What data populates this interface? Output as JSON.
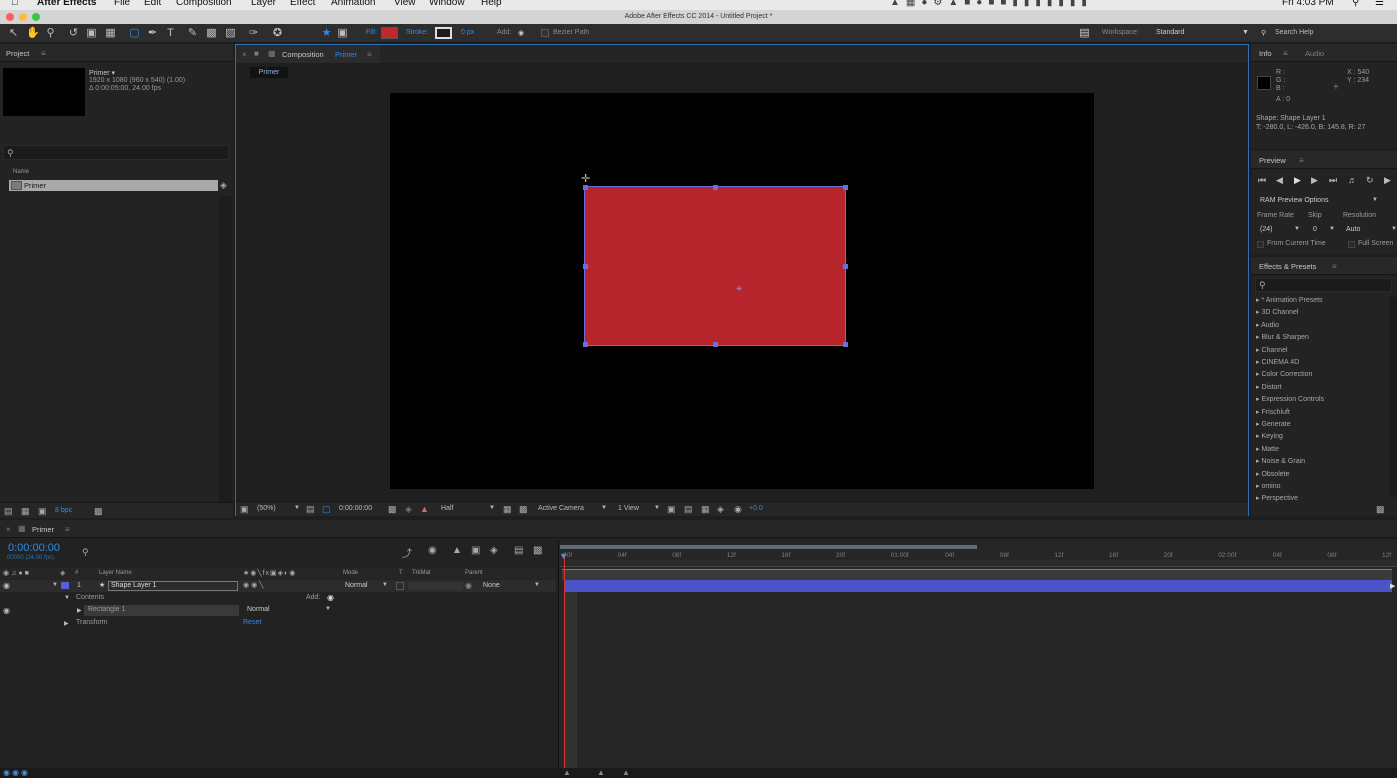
{
  "menubar": {
    "app": "After Effects",
    "items": [
      "File",
      "Edit",
      "Composition",
      "Layer",
      "Effect",
      "Animation",
      "View",
      "Window",
      "Help"
    ],
    "clock": "Fri 4:03 PM"
  },
  "window": {
    "title": "Adobe After Effects CC 2014 - Untitled Project *"
  },
  "toolbar": {
    "fill_label": "Fill:",
    "stroke_label": "Stroke:",
    "stroke_width": "0 px",
    "add_label": "Add:",
    "bezier_label": "Bezier Path",
    "workspace_label": "Workspace:",
    "workspace_value": "Standard",
    "search_help": "Search Help",
    "fill_color": "#c1272d"
  },
  "project": {
    "tab": "Project",
    "comp_name": "Primer ▾",
    "comp_info1": "1920 x 1080  (960 x 540) (1.00)",
    "comp_info2": "Δ 0:00:05:00, 24.00 fps",
    "column_name": "Name",
    "item_name": "Primer",
    "bpc": "8 bpc"
  },
  "composition": {
    "tab_prefix": "Composition",
    "tab_name": "Primer",
    "comp_label": "Primer",
    "zoom": "(50%)",
    "timecode": "0:00:00:00",
    "resolution": "Half",
    "camera": "Active Camera",
    "views": "1 View",
    "exposure": "+0.0",
    "shape_color": "#b5252b"
  },
  "info": {
    "tab": "Info",
    "tab2": "Audio",
    "r": "R :",
    "g": "G :",
    "b": "B :",
    "a": "A : 0",
    "x": "X : 540",
    "y": "Y : 234",
    "shape_line1": "Shape: Shape Layer 1",
    "shape_line2": "T: -280.0, L: -426.0, B: 145.8, R: 27"
  },
  "preview": {
    "tab": "Preview",
    "ram_options": "RAM Preview Options",
    "frame_rate_label": "Frame Rate",
    "skip_label": "Skip",
    "resolution_label": "Resolution",
    "frame_rate_value": "(24)",
    "skip_value": "0",
    "resolution_value": "Auto",
    "from_current": "From Current Time",
    "full_screen": "Full Screen"
  },
  "effects": {
    "tab": "Effects & Presets",
    "items": [
      "* Animation Presets",
      "3D Channel",
      "Audio",
      "Blur & Sharpen",
      "Channel",
      "CINEMA 4D",
      "Color Correction",
      "Distort",
      "Expression Controls",
      "Frischluft",
      "Generate",
      "Keying",
      "Matte",
      "Noise & Grain",
      "Obsolete",
      "omino",
      "Perspective"
    ]
  },
  "timeline": {
    "tab": "Primer",
    "timecode": "0:00:00:00",
    "frames": "00000 (24.00 fps)",
    "col_layer_name": "Layer Name",
    "col_mode": "Mode",
    "col_t": "T",
    "col_trkmat": "TrkMat",
    "col_parent": "Parent",
    "layer_num": "1",
    "layer_name": "Shape Layer 1",
    "layer_mode": "Normal",
    "layer_parent": "None",
    "contents_label": "Contents",
    "add_label": "Add:",
    "rect_label": "Rectangle 1",
    "rect_mode": "Normal",
    "transform_label": "Transform",
    "reset_label": "Reset",
    "ruler": [
      "00f",
      "04f",
      "08f",
      "12f",
      "16f",
      "20f",
      "01:00f",
      "04f",
      "08f",
      "12f",
      "16f",
      "20f",
      "02:00f",
      "04f",
      "08f",
      "12f"
    ]
  }
}
